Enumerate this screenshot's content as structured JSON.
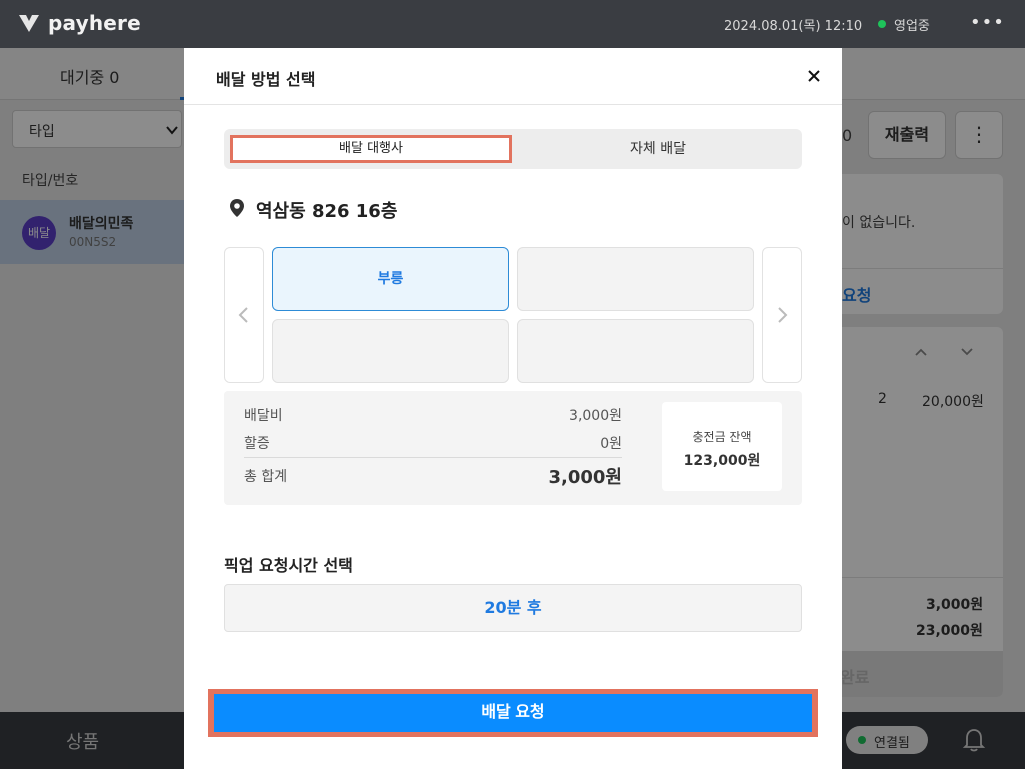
{
  "app": {
    "brand": "payhere",
    "datetime": "2024.08.01(목) 12:10",
    "status": "영업중",
    "more_label": "•••"
  },
  "tabs": {
    "waiting": "대기중 0"
  },
  "left_panel": {
    "type_select": "타입",
    "type_header": "타입/번호",
    "orders": [
      {
        "badge": "배달",
        "name": "배달의민족",
        "code": "00N5S2"
      }
    ]
  },
  "right_panel": {
    "count": "0",
    "reprint": "재출력",
    "kebab": "⋮",
    "empty_text": "이 없습니다.",
    "request_text": "요청",
    "item_qty": "2",
    "item_price": "20,000원",
    "delivery_fee": "3,000원",
    "total": "23,000원",
    "done": "완료"
  },
  "bottombar": {
    "product": "상품",
    "connected": "연결됨"
  },
  "modal": {
    "title": "배달 방법 선택",
    "segments": [
      "배달 대행사",
      "자체 배달"
    ],
    "address": "역삼동 826 16층",
    "agencies": [
      "부릉",
      "",
      "",
      ""
    ],
    "fees": {
      "delivery_label": "배달비",
      "delivery_value": "3,000원",
      "surcharge_label": "할증",
      "surcharge_value": "0원",
      "total_label": "총 합계",
      "total_value": "3,000원"
    },
    "balance": {
      "label": "충전금 잔액",
      "value": "123,000원"
    },
    "pickup_title": "픽업 요청시간 선택",
    "pickup_value": "20분 후",
    "request_button": "배달 요청"
  },
  "colors": {
    "accent": "#0a8cff",
    "link": "#1f7ae0",
    "highlight": "#e2735e",
    "topbar": "#3a3d42"
  }
}
